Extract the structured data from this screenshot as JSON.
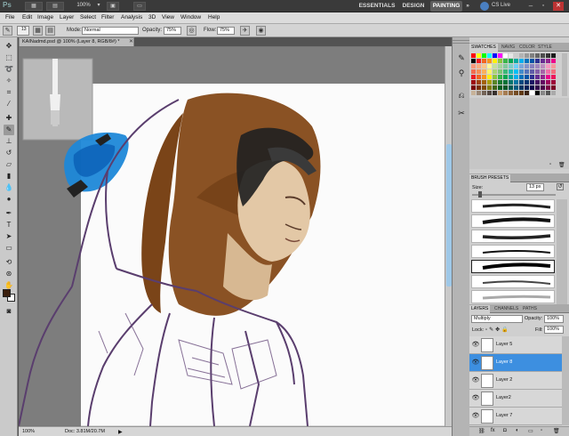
{
  "app": {
    "logo": "Ps",
    "zoom": "100%",
    "workspaces": [
      "ESSENTIALS",
      "DESIGN",
      "PAINTING"
    ],
    "active_workspace": "PAINTING",
    "cs_live": "CS Live"
  },
  "menu": [
    "File",
    "Edit",
    "Image",
    "Layer",
    "Select",
    "Filter",
    "Analysis",
    "3D",
    "View",
    "Window",
    "Help"
  ],
  "options": {
    "mode_label": "Mode:",
    "mode_value": "Normal",
    "opacity_label": "Opacity:",
    "opacity_value": "75%",
    "flow_label": "Flow:",
    "flow_value": "75%",
    "brush_size": "13"
  },
  "document": {
    "tab_title": "KAINadmd.psd @ 100% (Layer 8, RGB/8#) *",
    "zoom": "100%",
    "doc_info": "Doc: 3.81M/20.7M"
  },
  "swatches_panel": {
    "tabs": [
      "SWATCHES",
      "NAVIG",
      "COLOR",
      "STYLE"
    ],
    "colors": [
      "#ff0000",
      "#ffff00",
      "#00ff00",
      "#00ffff",
      "#0000ff",
      "#ff00ff",
      "#ffffff",
      "#e6e6e6",
      "#cccccc",
      "#b3b3b3",
      "#999999",
      "#808080",
      "#666666",
      "#4d4d4d",
      "#333333",
      "#1a1a1a",
      "#000000",
      "#ed1c24",
      "#f26522",
      "#f7941d",
      "#fff200",
      "#8dc63f",
      "#39b54a",
      "#00a651",
      "#00a99d",
      "#00aeef",
      "#0072bc",
      "#0054a6",
      "#2e3192",
      "#662d91",
      "#92278f",
      "#ec008c",
      "#f7977a",
      "#f9ad81",
      "#fdc68a",
      "#fff79a",
      "#c4df9b",
      "#a3d39c",
      "#82ca9d",
      "#7bcdc8",
      "#6ecff6",
      "#7ea7d8",
      "#8493ca",
      "#8882be",
      "#a187be",
      "#bc8dbf",
      "#f49ac2",
      "#f6989d",
      "#f26c4f",
      "#f68e55",
      "#fbaf5c",
      "#fff467",
      "#acd372",
      "#7cc576",
      "#3bb878",
      "#1abbb4",
      "#00bff3",
      "#438ccb",
      "#5574b9",
      "#605ca8",
      "#855fa8",
      "#a763a8",
      "#f06ea9",
      "#f26d7d",
      "#ed1c24",
      "#f26522",
      "#f7941d",
      "#fff200",
      "#8dc63f",
      "#39b54a",
      "#00a651",
      "#00a99d",
      "#00aeef",
      "#0072bc",
      "#0054a6",
      "#2e3192",
      "#662d91",
      "#92278f",
      "#ec008c",
      "#ed145b",
      "#9e0b0f",
      "#a0410d",
      "#a3620a",
      "#aba000",
      "#598527",
      "#197b30",
      "#007236",
      "#00746b",
      "#0076a3",
      "#004a80",
      "#003471",
      "#1b1464",
      "#440e62",
      "#630460",
      "#9e005d",
      "#9e0039",
      "#790000",
      "#7b2e00",
      "#7d4900",
      "#827b00",
      "#406618",
      "#005e20",
      "#005826",
      "#005952",
      "#005b7f",
      "#003663",
      "#002157",
      "#0d004c",
      "#32004b",
      "#4b0049",
      "#7b0046",
      "#7a0026",
      "#c7b299",
      "#998675",
      "#736357",
      "#534741",
      "#37302d",
      "#c69c6d",
      "#a67c52",
      "#8c6239",
      "#754c24",
      "#603913",
      "#3c2415",
      "#ffffff",
      "#000000",
      "#888888",
      "#555555",
      "#aaaaaa"
    ]
  },
  "brush_presets_panel": {
    "title": "BRUSH PRESETS",
    "size_label": "Size:",
    "size_value": "13 px"
  },
  "layers_panel": {
    "tabs": [
      "LAYERS",
      "CHANNELS",
      "PATHS"
    ],
    "blend_mode": "Multiply",
    "opacity_label": "Opacity:",
    "opacity_value": "100%",
    "lock_label": "Lock:",
    "fill_label": "Fill:",
    "fill_value": "100%",
    "layers": [
      {
        "name": "Layer 5",
        "selected": false
      },
      {
        "name": "Layer 8",
        "selected": true
      },
      {
        "name": "Layer 2",
        "selected": false
      },
      {
        "name": "Layer2",
        "selected": false
      },
      {
        "name": "Layer 7",
        "selected": false
      }
    ]
  },
  "colors": {
    "foreground": "#3b1f0d",
    "background": "#ffffff",
    "selection": "#3d8fe0"
  }
}
